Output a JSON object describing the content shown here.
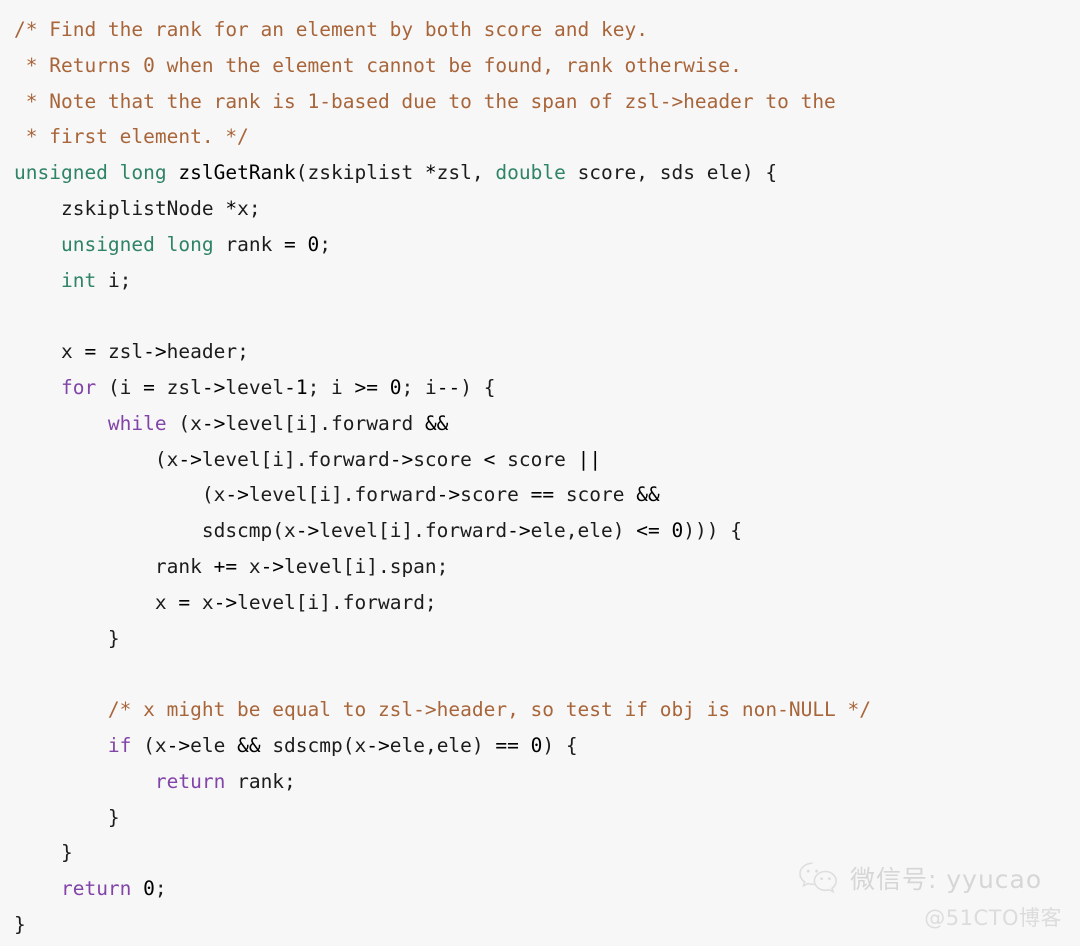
{
  "page": {
    "background_color": "#f7f7f7",
    "kind": "source-code-screenshot",
    "language": "C"
  },
  "theme": {
    "plain": "#1c1c1c",
    "comment": "#a8653a",
    "keyword": "#2e8464",
    "control": "#8244a8",
    "function": "#2222cc",
    "operator": "#9e3b3b",
    "number": "#2e8464"
  },
  "code": {
    "lines": [
      [
        {
          "t": "comment",
          "s": "/* Find the rank for an element by both score and key."
        }
      ],
      [
        {
          "t": "comment",
          "s": " * Returns 0 when the element cannot be found, rank otherwise."
        }
      ],
      [
        {
          "t": "comment",
          "s": " * Note that the rank is 1-based due to the span of zsl->header to the"
        }
      ],
      [
        {
          "t": "comment",
          "s": " * first element. */"
        }
      ],
      [
        {
          "t": "keyword",
          "s": "unsigned long "
        },
        {
          "t": "function",
          "s": "zslGetRank"
        },
        {
          "t": "plain",
          "s": "(zskiplist "
        },
        {
          "t": "operator",
          "s": "*"
        },
        {
          "t": "plain",
          "s": "zsl, "
        },
        {
          "t": "keyword",
          "s": "double"
        },
        {
          "t": "plain",
          "s": " score, sds ele) {"
        }
      ],
      [
        {
          "t": "plain",
          "s": "    zskiplistNode "
        },
        {
          "t": "operator",
          "s": "*"
        },
        {
          "t": "plain",
          "s": "x;"
        }
      ],
      [
        {
          "t": "plain",
          "s": "    "
        },
        {
          "t": "keyword",
          "s": "unsigned long "
        },
        {
          "t": "plain",
          "s": "rank "
        },
        {
          "t": "operator",
          "s": "="
        },
        {
          "t": "plain",
          "s": " "
        },
        {
          "t": "number",
          "s": "0"
        },
        {
          "t": "plain",
          "s": ";"
        }
      ],
      [
        {
          "t": "plain",
          "s": "    "
        },
        {
          "t": "keyword",
          "s": "int"
        },
        {
          "t": "plain",
          "s": " i;"
        }
      ],
      [],
      [
        {
          "t": "plain",
          "s": "    x "
        },
        {
          "t": "operator",
          "s": "="
        },
        {
          "t": "plain",
          "s": " zsl"
        },
        {
          "t": "operator",
          "s": "->"
        },
        {
          "t": "plain",
          "s": "header;"
        }
      ],
      [
        {
          "t": "plain",
          "s": "    "
        },
        {
          "t": "control",
          "s": "for"
        },
        {
          "t": "plain",
          "s": " (i "
        },
        {
          "t": "operator",
          "s": "="
        },
        {
          "t": "plain",
          "s": " zsl"
        },
        {
          "t": "operator",
          "s": "->"
        },
        {
          "t": "plain",
          "s": "level"
        },
        {
          "t": "operator",
          "s": "-"
        },
        {
          "t": "number",
          "s": "1"
        },
        {
          "t": "plain",
          "s": "; i "
        },
        {
          "t": "operator",
          "s": ">="
        },
        {
          "t": "plain",
          "s": " "
        },
        {
          "t": "number",
          "s": "0"
        },
        {
          "t": "plain",
          "s": "; i"
        },
        {
          "t": "operator",
          "s": "--"
        },
        {
          "t": "plain",
          "s": ") {"
        }
      ],
      [
        {
          "t": "plain",
          "s": "        "
        },
        {
          "t": "control",
          "s": "while"
        },
        {
          "t": "plain",
          "s": " (x"
        },
        {
          "t": "operator",
          "s": "->"
        },
        {
          "t": "plain",
          "s": "level[i].forward "
        },
        {
          "t": "operator",
          "s": "&&"
        }
      ],
      [
        {
          "t": "plain",
          "s": "            (x"
        },
        {
          "t": "operator",
          "s": "->"
        },
        {
          "t": "plain",
          "s": "level[i].forward"
        },
        {
          "t": "operator",
          "s": "->"
        },
        {
          "t": "plain",
          "s": "score "
        },
        {
          "t": "operator",
          "s": "<"
        },
        {
          "t": "plain",
          "s": " score "
        },
        {
          "t": "operator",
          "s": "||"
        }
      ],
      [
        {
          "t": "plain",
          "s": "                (x"
        },
        {
          "t": "operator",
          "s": "->"
        },
        {
          "t": "plain",
          "s": "level[i].forward"
        },
        {
          "t": "operator",
          "s": "->"
        },
        {
          "t": "plain",
          "s": "score "
        },
        {
          "t": "operator",
          "s": "=="
        },
        {
          "t": "plain",
          "s": " score "
        },
        {
          "t": "operator",
          "s": "&&"
        }
      ],
      [
        {
          "t": "plain",
          "s": "                sdscmp(x"
        },
        {
          "t": "operator",
          "s": "->"
        },
        {
          "t": "plain",
          "s": "level[i].forward"
        },
        {
          "t": "operator",
          "s": "->"
        },
        {
          "t": "plain",
          "s": "ele,ele) "
        },
        {
          "t": "operator",
          "s": "<="
        },
        {
          "t": "plain",
          "s": " "
        },
        {
          "t": "number",
          "s": "0"
        },
        {
          "t": "plain",
          "s": "))) {"
        }
      ],
      [
        {
          "t": "plain",
          "s": "            rank "
        },
        {
          "t": "operator",
          "s": "+="
        },
        {
          "t": "plain",
          "s": " x"
        },
        {
          "t": "operator",
          "s": "->"
        },
        {
          "t": "plain",
          "s": "level[i].span;"
        }
      ],
      [
        {
          "t": "plain",
          "s": "            x "
        },
        {
          "t": "operator",
          "s": "="
        },
        {
          "t": "plain",
          "s": " x"
        },
        {
          "t": "operator",
          "s": "->"
        },
        {
          "t": "plain",
          "s": "level[i].forward;"
        }
      ],
      [
        {
          "t": "plain",
          "s": "        }"
        }
      ],
      [],
      [
        {
          "t": "plain",
          "s": "        "
        },
        {
          "t": "comment",
          "s": "/* x might be equal to zsl->header, so test if obj is non-NULL */"
        }
      ],
      [
        {
          "t": "plain",
          "s": "        "
        },
        {
          "t": "control",
          "s": "if"
        },
        {
          "t": "plain",
          "s": " (x"
        },
        {
          "t": "operator",
          "s": "->"
        },
        {
          "t": "plain",
          "s": "ele "
        },
        {
          "t": "operator",
          "s": "&&"
        },
        {
          "t": "plain",
          "s": " sdscmp(x"
        },
        {
          "t": "operator",
          "s": "->"
        },
        {
          "t": "plain",
          "s": "ele,ele) "
        },
        {
          "t": "operator",
          "s": "=="
        },
        {
          "t": "plain",
          "s": " "
        },
        {
          "t": "number",
          "s": "0"
        },
        {
          "t": "plain",
          "s": ") {"
        }
      ],
      [
        {
          "t": "plain",
          "s": "            "
        },
        {
          "t": "control",
          "s": "return"
        },
        {
          "t": "plain",
          "s": " rank;"
        }
      ],
      [
        {
          "t": "plain",
          "s": "        }"
        }
      ],
      [
        {
          "t": "plain",
          "s": "    }"
        }
      ],
      [
        {
          "t": "plain",
          "s": "    "
        },
        {
          "t": "control",
          "s": "return"
        },
        {
          "t": "plain",
          "s": " "
        },
        {
          "t": "number",
          "s": "0"
        },
        {
          "t": "plain",
          "s": ";"
        }
      ],
      [
        {
          "t": "plain",
          "s": "}"
        }
      ]
    ]
  },
  "watermark": {
    "icon": "wechat-icon",
    "label": "微信号: yyucao",
    "source": "@51CTO博客",
    "color": "#d6d6d6"
  }
}
